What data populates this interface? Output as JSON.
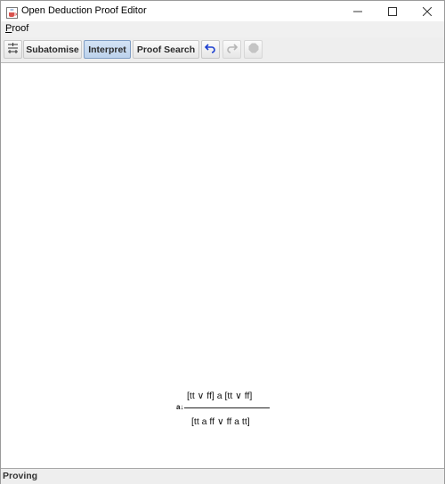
{
  "window": {
    "title": "Open Deduction Proof Editor",
    "app_icon": "java-cup-icon",
    "controls": {
      "minimize": "minimize-icon",
      "maximize": "maximize-icon",
      "close": "close-icon"
    }
  },
  "menubar": {
    "items": [
      {
        "label": "Proof",
        "mnemonic": "P",
        "rest": "roof"
      }
    ]
  },
  "toolbar": {
    "structure_icon": "structure-icon",
    "subatomise_label": "Subatomise",
    "interpret_label": "Interpret",
    "interpret_active": true,
    "proof_search_label": "Proof Search",
    "undo_icon": "undo-icon",
    "redo_icon": "redo-icon",
    "stop_icon": "stop-icon",
    "colors": {
      "undo": "#1c3fd0",
      "disabled": "#b5b5b5",
      "active_bg": "#c6d9f0"
    }
  },
  "proof": {
    "rule_name": "a↓",
    "premise": "[tt ∨ ff] a [tt ∨ ff]",
    "conclusion": "[tt a ff ∨ ff a tt]"
  },
  "status": {
    "text": "Proving"
  }
}
